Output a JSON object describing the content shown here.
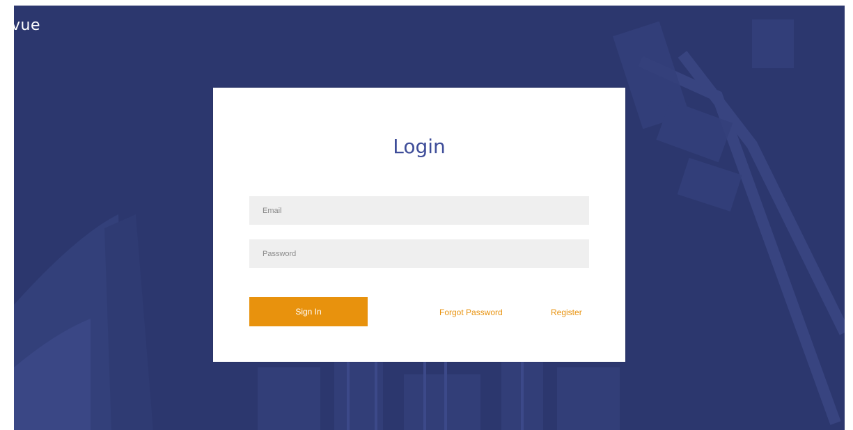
{
  "brand": {
    "logo_text": "vue"
  },
  "login": {
    "title": "Login",
    "email_placeholder": "Email",
    "password_placeholder": "Password",
    "signin_label": "Sign In",
    "forgot_label": "Forgot Password",
    "register_label": "Register"
  },
  "colors": {
    "background": "#2c376e",
    "accent": "#e8920d",
    "title": "#3e4d99",
    "field_background": "#efefef"
  }
}
